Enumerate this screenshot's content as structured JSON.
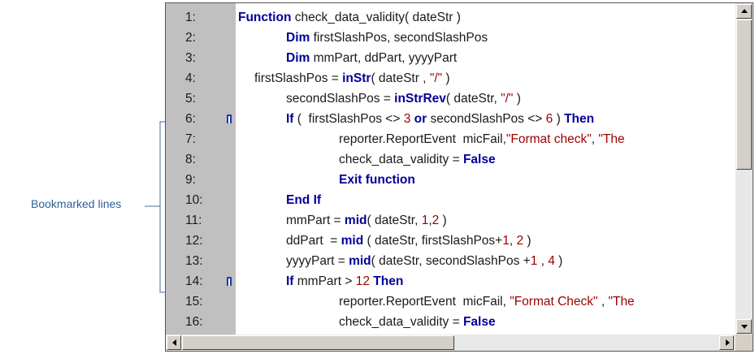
{
  "callout": {
    "label": "Bookmarked lines"
  },
  "editor": {
    "lines": [
      {
        "n": "1:",
        "segs": [
          {
            "t": "Function",
            "c": "kw"
          },
          {
            "t": " check_data_validity( dateStr )"
          }
        ]
      },
      {
        "n": "2:",
        "segs": [
          {
            "t": "Dim",
            "c": "kw"
          },
          {
            "t": " firstSlashPos, secondSlashPos"
          }
        ]
      },
      {
        "n": "3:",
        "segs": [
          {
            "t": "Dim",
            "c": "kw"
          },
          {
            "t": " mmPart, ddPart, yyyyPart"
          }
        ]
      },
      {
        "n": "4:",
        "segs": [
          {
            "t": "firstSlashPos = "
          },
          {
            "t": "inStr",
            "c": "kw"
          },
          {
            "t": "( dateStr , "
          },
          {
            "t": "\"/\"",
            "c": "str"
          },
          {
            "t": " )"
          }
        ]
      },
      {
        "n": "5:",
        "segs": [
          {
            "t": "secondSlashPos = "
          },
          {
            "t": "inStrRev",
            "c": "kw"
          },
          {
            "t": "( dateStr, "
          },
          {
            "t": "\"/\"",
            "c": "str"
          },
          {
            "t": " )"
          }
        ]
      },
      {
        "n": "6:",
        "bookmark": true,
        "segs": [
          {
            "t": "If",
            "c": "kw"
          },
          {
            "t": " (  firstSlashPos <> "
          },
          {
            "t": "3",
            "c": "num"
          },
          {
            "t": " "
          },
          {
            "t": "or",
            "c": "kw"
          },
          {
            "t": " secondSlashPos <> "
          },
          {
            "t": "6",
            "c": "num"
          },
          {
            "t": " ) "
          },
          {
            "t": "Then",
            "c": "kw"
          }
        ]
      },
      {
        "n": "7:",
        "segs": [
          {
            "t": "reporter.ReportEvent  micFail,"
          },
          {
            "t": "\"Format check\"",
            "c": "str"
          },
          {
            "t": ", "
          },
          {
            "t": "\"The",
            "c": "str"
          }
        ]
      },
      {
        "n": "8:",
        "segs": [
          {
            "t": "check_data_validity = "
          },
          {
            "t": "False",
            "c": "kw"
          }
        ]
      },
      {
        "n": "9:",
        "segs": [
          {
            "t": "Exit function",
            "c": "kw"
          }
        ]
      },
      {
        "n": "10:",
        "segs": [
          {
            "t": "End If",
            "c": "kw"
          }
        ]
      },
      {
        "n": "11:",
        "segs": [
          {
            "t": "mmPart = "
          },
          {
            "t": "mid",
            "c": "kw"
          },
          {
            "t": "( dateStr, "
          },
          {
            "t": "1",
            "c": "num"
          },
          {
            "t": ","
          },
          {
            "t": "2",
            "c": "num"
          },
          {
            "t": " )"
          }
        ]
      },
      {
        "n": "12:",
        "segs": [
          {
            "t": "ddPart  = "
          },
          {
            "t": "mid",
            "c": "kw"
          },
          {
            "t": " ( dateStr, firstSlashPos+"
          },
          {
            "t": "1",
            "c": "num"
          },
          {
            "t": ", "
          },
          {
            "t": "2",
            "c": "num"
          },
          {
            "t": " )"
          }
        ]
      },
      {
        "n": "13:",
        "segs": [
          {
            "t": "yyyyPart = "
          },
          {
            "t": "mid",
            "c": "kw"
          },
          {
            "t": "( dateStr, secondSlashPos +"
          },
          {
            "t": "1",
            "c": "num"
          },
          {
            "t": " , "
          },
          {
            "t": "4",
            "c": "num"
          },
          {
            "t": " )"
          }
        ]
      },
      {
        "n": "14:",
        "bookmark": true,
        "segs": [
          {
            "t": "If",
            "c": "kw"
          },
          {
            "t": " mmPart > "
          },
          {
            "t": "12",
            "c": "num"
          },
          {
            "t": " "
          },
          {
            "t": "Then",
            "c": "kw"
          }
        ]
      },
      {
        "n": "15:",
        "segs": [
          {
            "t": "reporter.ReportEvent  micFail, "
          },
          {
            "t": "\"Format Check\"",
            "c": "str"
          },
          {
            "t": " , "
          },
          {
            "t": "\"The",
            "c": "str"
          }
        ]
      },
      {
        "n": "16:",
        "segs": [
          {
            "t": "check_data_validity = "
          },
          {
            "t": "False",
            "c": "kw"
          }
        ]
      }
    ]
  }
}
